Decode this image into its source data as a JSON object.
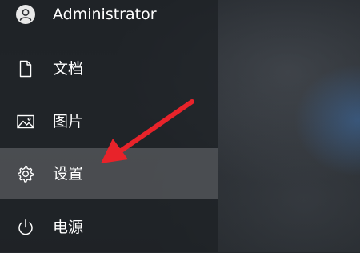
{
  "user": {
    "name": "Administrator",
    "avatar_icon": "user-avatar-icon"
  },
  "menu": {
    "items": [
      {
        "label": "文档",
        "icon": "document-icon"
      },
      {
        "label": "图片",
        "icon": "picture-icon"
      },
      {
        "label": "设置",
        "icon": "gear-icon",
        "highlighted": true
      },
      {
        "label": "电源",
        "icon": "power-icon"
      }
    ]
  },
  "annotation": {
    "arrow_color": "#e8232a"
  },
  "colors": {
    "panel": "#1e2125",
    "highlight": "#6e7072",
    "text": "#ffffff"
  }
}
